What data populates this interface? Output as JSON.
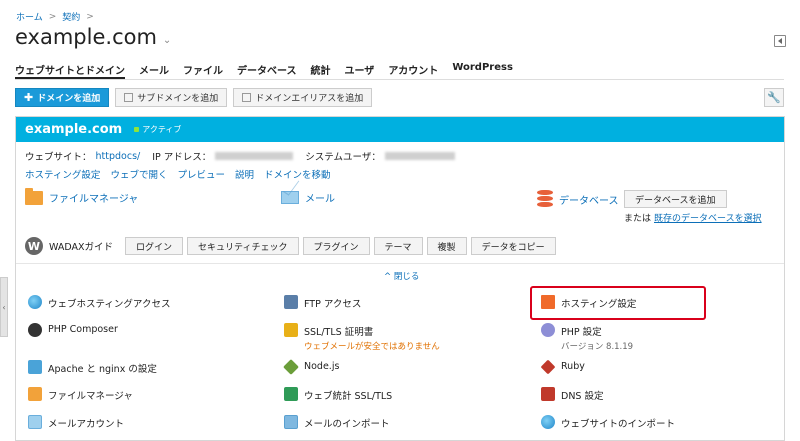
{
  "breadcrumb": {
    "home": "ホーム",
    "sep": ">",
    "contract": "契約",
    "sep2": ">"
  },
  "title": "example.com",
  "tabs": [
    "ウェブサイトとドメイン",
    "メール",
    "ファイル",
    "データベース",
    "統計",
    "ユーザ",
    "アカウント",
    "WordPress"
  ],
  "toolbar": {
    "add_domain": "ドメインを追加",
    "add_subdomain": "サブドメインを追加",
    "add_alias": "ドメインエイリアスを追加"
  },
  "panel": {
    "domain": "example.com",
    "status": "アクティブ",
    "website_label": "ウェブサイト：",
    "website_path": "httpdocs/",
    "ip_label": "IP アドレス：",
    "sysuser_label": "システムユーザ：",
    "links": [
      "ホスティング設定",
      "ウェブで開く",
      "プレビュー",
      "説明",
      "ドメインを移動"
    ],
    "quick": {
      "file_manager": "ファイルマネージャ",
      "mail": "メール",
      "database": "データベース",
      "add_database": "データベースを追加",
      "or": "または",
      "select_existing": "既存のデータベースを選択"
    },
    "wadax": {
      "label": "WADAXガイド",
      "buttons": [
        "ログイン",
        "セキュリティチェック",
        "プラグイン",
        "テーマ",
        "複製",
        "データをコピー"
      ]
    },
    "close": "^ 閉じる",
    "items": {
      "web_hosting_access": "ウェブホスティングアクセス",
      "ftp_access": "FTP アクセス",
      "hosting_settings": "ホスティング設定",
      "php_composer": "PHP Composer",
      "ssl_tls": "SSL/TLS 証明書",
      "ssl_warn": "ウェブメールが安全ではありません",
      "php_settings": "PHP 設定",
      "php_version": "バージョン 8.1.19",
      "apache_nginx": "Apache と nginx の設定",
      "nodejs": "Node.js",
      "ruby": "Ruby",
      "file_manager": "ファイルマネージャ",
      "web_stats_ssl": "ウェブ統計 SSL/TLS",
      "dns": "DNS 設定",
      "mail_accounts": "メールアカウント",
      "mail_import": "メールのインポート",
      "site_import": "ウェブサイトのインポート"
    }
  },
  "colors": {
    "header_blue": "#00b0e0",
    "primary_btn": "#1b9ad9",
    "link": "#0c6fb8",
    "warn": "#e07000",
    "highlight": "#d9001b"
  }
}
